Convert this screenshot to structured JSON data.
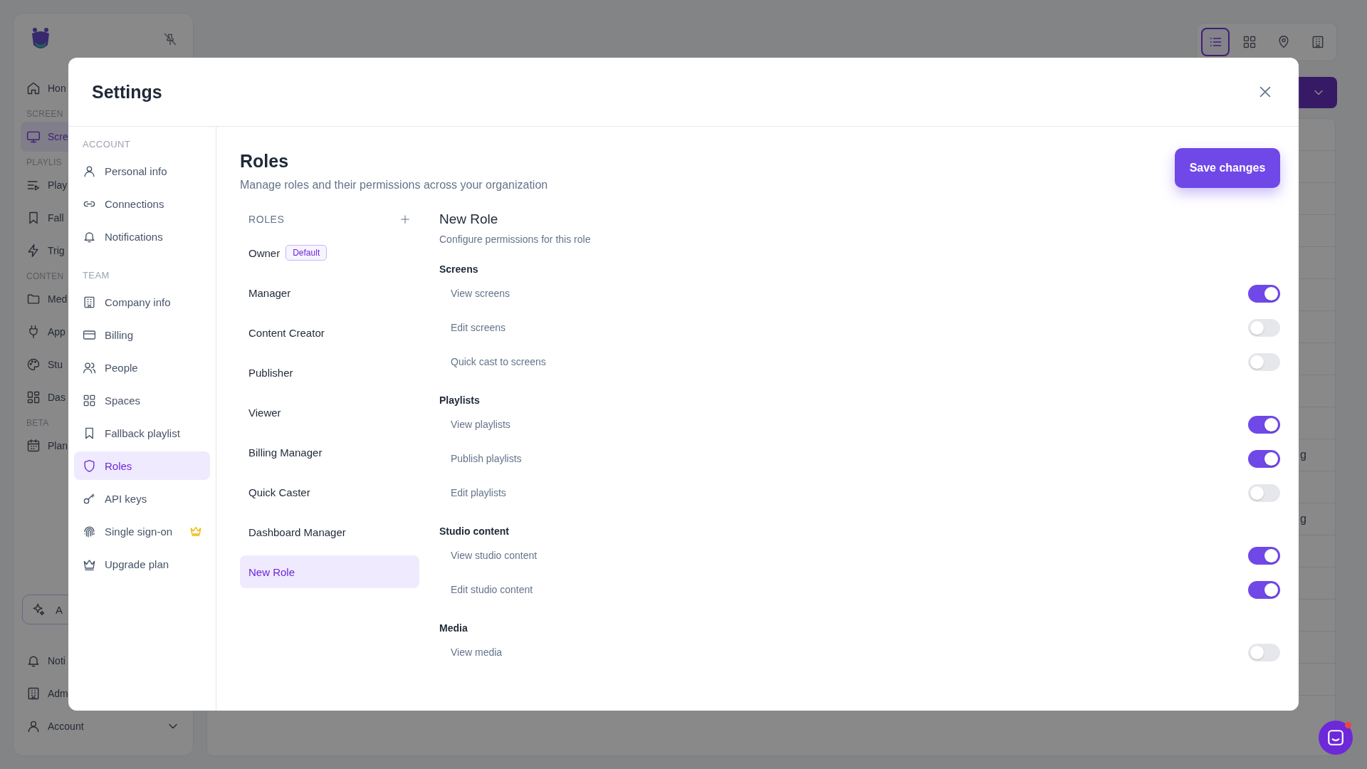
{
  "background": {
    "sidebar": {
      "items": [
        {
          "kind": "item",
          "label": "Hon",
          "selected": false
        },
        {
          "kind": "section",
          "label": "SCREEN"
        },
        {
          "kind": "item",
          "label": "Scre",
          "selected": true
        },
        {
          "kind": "section",
          "label": "PLAYLIS"
        },
        {
          "kind": "item",
          "label": "Play",
          "selected": false
        },
        {
          "kind": "item",
          "label": "Fall",
          "selected": false
        },
        {
          "kind": "item",
          "label": "Trig",
          "selected": false
        },
        {
          "kind": "section",
          "label": "CONTEN"
        },
        {
          "kind": "item",
          "label": "Med",
          "selected": false
        },
        {
          "kind": "item",
          "label": "App",
          "selected": false
        },
        {
          "kind": "item",
          "label": "Stu",
          "selected": false
        },
        {
          "kind": "item",
          "label": "Das",
          "selected": false
        },
        {
          "kind": "section",
          "label": "BETA"
        },
        {
          "kind": "item",
          "label": "Plan",
          "selected": false
        }
      ],
      "assistant_button": "A",
      "footer": [
        {
          "label": "Noti"
        },
        {
          "label": "Adm"
        },
        {
          "label": "Account"
        }
      ]
    },
    "view_switcher": [
      {
        "selected": true
      },
      {
        "selected": false
      },
      {
        "selected": false
      },
      {
        "selected": false
      }
    ],
    "table_fragments": [
      "g",
      "g"
    ]
  },
  "settings": {
    "title": "Settings",
    "nav": [
      {
        "title": "ACCOUNT",
        "items": [
          {
            "label": "Personal info",
            "selected": false,
            "premium": false
          },
          {
            "label": "Connections",
            "selected": false,
            "premium": false
          },
          {
            "label": "Notifications",
            "selected": false,
            "premium": false
          }
        ]
      },
      {
        "title": "TEAM",
        "items": [
          {
            "label": "Company info",
            "selected": false,
            "premium": false
          },
          {
            "label": "Billing",
            "selected": false,
            "premium": false
          },
          {
            "label": "People",
            "selected": false,
            "premium": false
          },
          {
            "label": "Spaces",
            "selected": false,
            "premium": false
          },
          {
            "label": "Fallback playlist",
            "selected": false,
            "premium": false
          },
          {
            "label": "Roles",
            "selected": true,
            "premium": false
          },
          {
            "label": "API keys",
            "selected": false,
            "premium": false
          },
          {
            "label": "Single sign-on",
            "selected": false,
            "premium": true
          },
          {
            "label": "Upgrade plan",
            "selected": false,
            "premium": false
          }
        ]
      }
    ],
    "page": {
      "title": "Roles",
      "subtitle": "Manage roles and their permissions across your organization",
      "save_button": "Save changes"
    },
    "roles": {
      "header": "ROLES",
      "items": [
        {
          "label": "Owner",
          "badge": "Default",
          "selected": false
        },
        {
          "label": "Manager",
          "selected": false
        },
        {
          "label": "Content Creator",
          "selected": false
        },
        {
          "label": "Publisher",
          "selected": false
        },
        {
          "label": "Viewer",
          "selected": false
        },
        {
          "label": "Billing Manager",
          "selected": false
        },
        {
          "label": "Quick Caster",
          "selected": false
        },
        {
          "label": "Dashboard Manager",
          "selected": false
        },
        {
          "label": "New Role",
          "selected": true
        }
      ]
    },
    "role_detail": {
      "title": "New Role",
      "subtitle": "Configure permissions for this role",
      "groups": [
        {
          "title": "Screens",
          "permissions": [
            {
              "label": "View screens",
              "on": true
            },
            {
              "label": "Edit screens",
              "on": false
            },
            {
              "label": "Quick cast to screens",
              "on": false
            }
          ]
        },
        {
          "title": "Playlists",
          "permissions": [
            {
              "label": "View playlists",
              "on": true
            },
            {
              "label": "Publish playlists",
              "on": true
            },
            {
              "label": "Edit playlists",
              "on": false
            }
          ]
        },
        {
          "title": "Studio content",
          "permissions": [
            {
              "label": "View studio content",
              "on": true
            },
            {
              "label": "Edit studio content",
              "on": true
            }
          ]
        },
        {
          "title": "Media",
          "permissions": [
            {
              "label": "View media",
              "on": false
            }
          ]
        }
      ]
    }
  }
}
